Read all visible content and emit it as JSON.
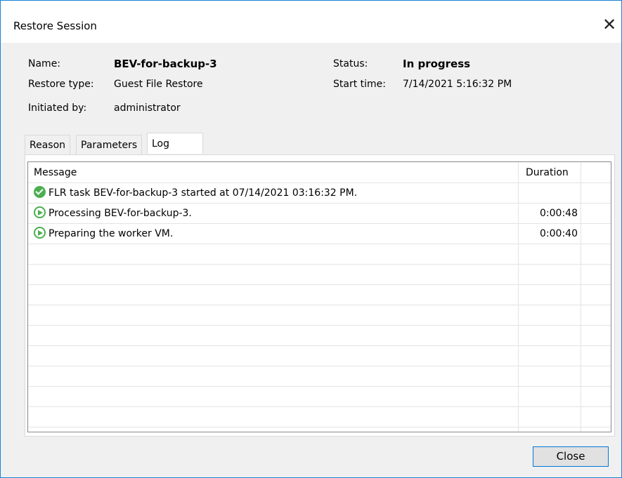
{
  "window": {
    "title": "Restore Session",
    "close_glyph": "✕"
  },
  "info": {
    "name_label": "Name:",
    "name_value": "BEV-for-backup-3",
    "restore_type_label": "Restore type:",
    "restore_type_value": "Guest File Restore",
    "initiated_by_label": "Initiated by:",
    "initiated_by_value": "administrator",
    "status_label": "Status:",
    "status_value": "In progress",
    "start_time_label": "Start time:",
    "start_time_value": "7/14/2021 5:16:32 PM"
  },
  "tabs": [
    {
      "label": "Reason",
      "active": false
    },
    {
      "label": "Parameters",
      "active": false
    },
    {
      "label": "Log",
      "active": true
    }
  ],
  "log": {
    "columns": {
      "message": "Message",
      "duration": "Duration"
    },
    "rows": [
      {
        "icon": "success-check-icon",
        "message": "FLR task BEV-for-backup-3 started at 07/14/2021 03:16:32 PM.",
        "duration": ""
      },
      {
        "icon": "running-play-icon",
        "message": "Processing BEV-for-backup-3.",
        "duration": "0:00:48"
      },
      {
        "icon": "running-play-icon",
        "message": "Preparing the worker VM.",
        "duration": "0:00:40"
      }
    ]
  },
  "buttons": {
    "close_label": "Close"
  },
  "colors": {
    "accent": "#0078d7",
    "success": "#4caf50"
  }
}
